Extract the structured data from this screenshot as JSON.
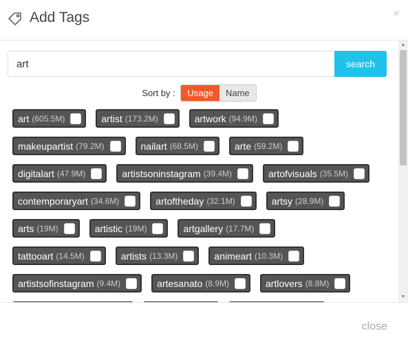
{
  "header": {
    "title": "Add Tags",
    "close_glyph": "×",
    "icon": "tag-icon"
  },
  "search": {
    "value": "art",
    "button_label": "search"
  },
  "sort": {
    "label": "Sort by :",
    "options": [
      "Usage",
      "Name"
    ],
    "active": "Usage"
  },
  "tags": [
    [
      {
        "name": "art",
        "count": "(605.5M)"
      },
      {
        "name": "artist",
        "count": "(173.2M)"
      },
      {
        "name": "artwork",
        "count": "(94.9M)"
      }
    ],
    [
      {
        "name": "makeupartist",
        "count": "(79.2M)"
      },
      {
        "name": "nailart",
        "count": "(68.5M)"
      },
      {
        "name": "arte",
        "count": "(59.2M)"
      }
    ],
    [
      {
        "name": "digitalart",
        "count": "(47.9M)"
      },
      {
        "name": "artistsoninstagram",
        "count": "(39.4M)"
      },
      {
        "name": "artofvisuals",
        "count": "(35.5M)"
      }
    ],
    [
      {
        "name": "contemporaryart",
        "count": "(34.6M)"
      },
      {
        "name": "artoftheday",
        "count": "(32.1M)"
      },
      {
        "name": "artsy",
        "count": "(28.9M)"
      }
    ],
    [
      {
        "name": "arts",
        "count": "(19M)"
      },
      {
        "name": "artistic",
        "count": "(19M)"
      },
      {
        "name": "artgallery",
        "count": "(17.7M)"
      }
    ],
    [
      {
        "name": "tattooart",
        "count": "(14.5M)"
      },
      {
        "name": "artists",
        "count": "(13.3M)"
      },
      {
        "name": "animeart",
        "count": "(10.3M)"
      }
    ],
    [
      {
        "name": "artistsofinstagram",
        "count": "(9.4M)"
      },
      {
        "name": "artesanato",
        "count": "(8.9M)"
      },
      {
        "name": "artlovers",
        "count": "(8.8M)"
      }
    ]
  ],
  "footer": {
    "close_label": "close"
  },
  "colors": {
    "accent": "#21c2ea",
    "sort_active": "#f05a2b",
    "tag_bg": "#555555"
  }
}
